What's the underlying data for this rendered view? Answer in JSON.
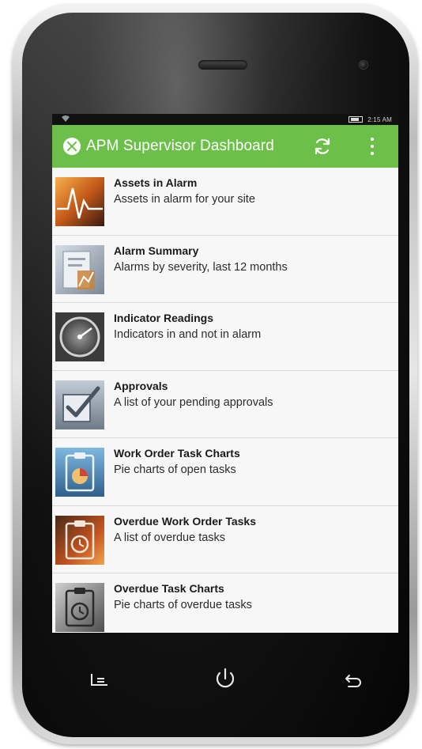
{
  "status_bar": {
    "time": "2:15 AM"
  },
  "app_bar": {
    "title": "APM Supervisor Dashboard",
    "background_color": "#6cc04a",
    "logo_icon": "apm-logo-icon",
    "refresh_icon": "refresh-icon",
    "menu_icon": "overflow-menu-icon"
  },
  "menu": {
    "items": [
      {
        "title": "Assets in Alarm",
        "subtitle": "Assets in alarm for your site",
        "icon": "pulse-chart-icon"
      },
      {
        "title": "Alarm Summary",
        "subtitle": "Alarms by severity, last 12 months",
        "icon": "summary-document-icon"
      },
      {
        "title": "Indicator Readings",
        "subtitle": "Indicators in and not in alarm",
        "icon": "gauge-icon"
      },
      {
        "title": "Approvals",
        "subtitle": "A list of your pending approvals",
        "icon": "checkbox-approval-icon"
      },
      {
        "title": "Work Order Task Charts",
        "subtitle": "Pie charts of open tasks",
        "icon": "clipboard-pie-icon"
      },
      {
        "title": "Overdue Work Order Tasks",
        "subtitle": "A list of overdue tasks",
        "icon": "clipboard-clock-icon"
      },
      {
        "title": "Overdue Task Charts",
        "subtitle": "Pie charts of overdue tasks",
        "icon": "clipboard-clock-chart-icon"
      }
    ]
  },
  "nav_keys": {
    "menu_icon": "menu-key-icon",
    "power_icon": "power-icon",
    "back_icon": "back-icon"
  }
}
